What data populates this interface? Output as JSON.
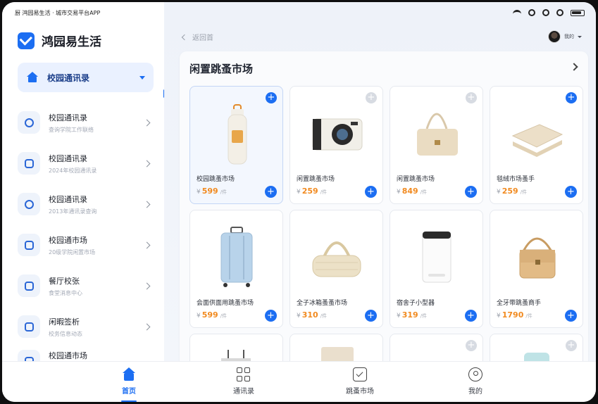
{
  "statusbar": {
    "left_text": "厨 鸿园易生活 · 城市交易平台APP"
  },
  "app": {
    "name": "鸿园易生活"
  },
  "sidebar": {
    "selected": {
      "label": "校园通讯录"
    },
    "items": [
      {
        "title": "校园通讯录",
        "subtitle": "查询学院工作联络"
      },
      {
        "title": "校园通讯录",
        "subtitle": "2024年校园通讯录"
      },
      {
        "title": "校园通讯录",
        "subtitle": "2013年通讯录查询"
      },
      {
        "title": "校园通市场",
        "subtitle": "20级学院闲置市场"
      },
      {
        "title": "餐厅校张",
        "subtitle": "食堂消息中心"
      },
      {
        "title": "闲暇签析",
        "subtitle": "校务信息动态"
      },
      {
        "title": "校园通市场",
        "subtitle": ""
      }
    ]
  },
  "header": {
    "back_label": "返回首",
    "user_name": "我的"
  },
  "market": {
    "title": "闲置跳蚤市场",
    "products": [
      {
        "name": "校园跳蚤市场",
        "price": "599",
        "unit": "/件"
      },
      {
        "name": "闲置跳蚤市场",
        "price": "259",
        "unit": "/件"
      },
      {
        "name": "闲置跳蚤市场",
        "price": "849",
        "unit": "/件"
      },
      {
        "name": "毯绒市场蚤手",
        "price": "259",
        "unit": "/件"
      },
      {
        "name": "会面供面用跳蚤市场",
        "price": "599",
        "unit": "/件"
      },
      {
        "name": "全子冰箱蚤蚤市场",
        "price": "310",
        "unit": "/件"
      },
      {
        "name": "宿舍子小型器",
        "price": "319",
        "unit": "/件"
      },
      {
        "name": "全牙带跳蚤商手",
        "price": "1790",
        "unit": "/件"
      }
    ],
    "currency": "¥"
  },
  "tabs": [
    {
      "label": "首页"
    },
    {
      "label": "通讯录"
    },
    {
      "label": "跳蚤市场"
    },
    {
      "label": "我的"
    }
  ]
}
